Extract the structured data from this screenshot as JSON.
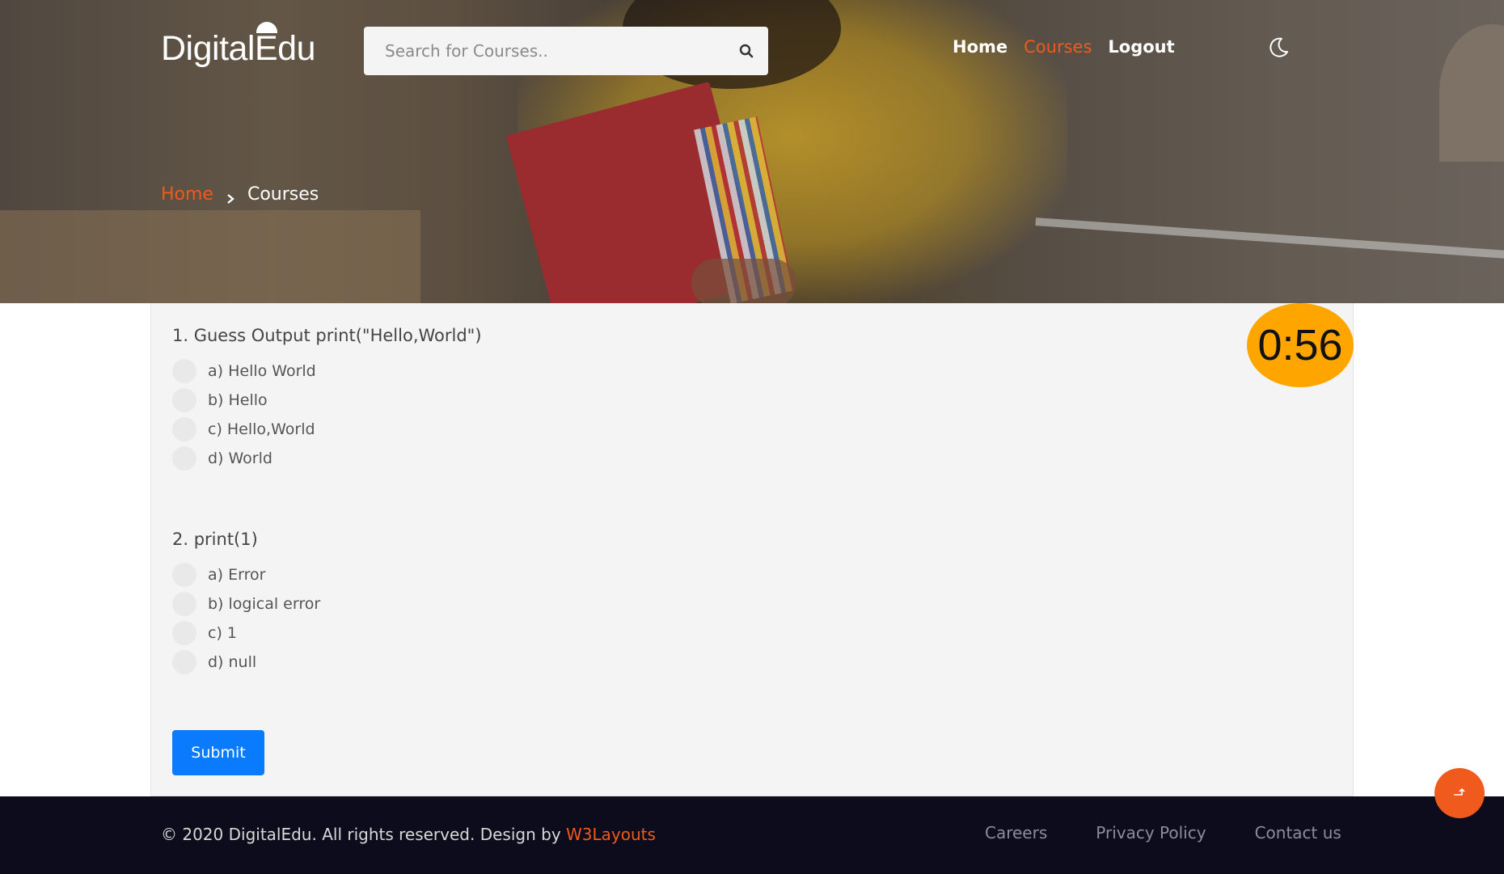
{
  "header": {
    "logo_text": "DigitalEdu",
    "search": {
      "placeholder": "Search for Courses..",
      "value": ""
    },
    "nav": [
      {
        "label": "Home",
        "active": false
      },
      {
        "label": "Courses",
        "active": true
      },
      {
        "label": "Logout",
        "active": false
      }
    ],
    "theme_toggle_icon": "moon-icon"
  },
  "breadcrumb": {
    "home": "Home",
    "current": "Courses"
  },
  "quiz": {
    "timer": "0:56",
    "questions": [
      {
        "title": "1. Guess Output print(\"Hello,World\")",
        "options": [
          "a) Hello World",
          "b) Hello",
          "c) Hello,World",
          "d) World"
        ]
      },
      {
        "title": "2. print(1)",
        "options": [
          "a) Error",
          "b) logical error",
          "c) 1",
          "d) null"
        ]
      }
    ],
    "submit_label": "Submit"
  },
  "footer": {
    "copyright_prefix": "© 2020 DigitalEdu. All rights reserved. Design by ",
    "copyright_brand": "W3Layouts",
    "links": [
      "Careers",
      "Privacy Policy",
      "Contact us"
    ]
  },
  "colors": {
    "accent": "#f05a1c",
    "primary_button": "#0a7bfd",
    "timer_bg": "#ffa500",
    "footer_bg": "#0c0c1c"
  }
}
